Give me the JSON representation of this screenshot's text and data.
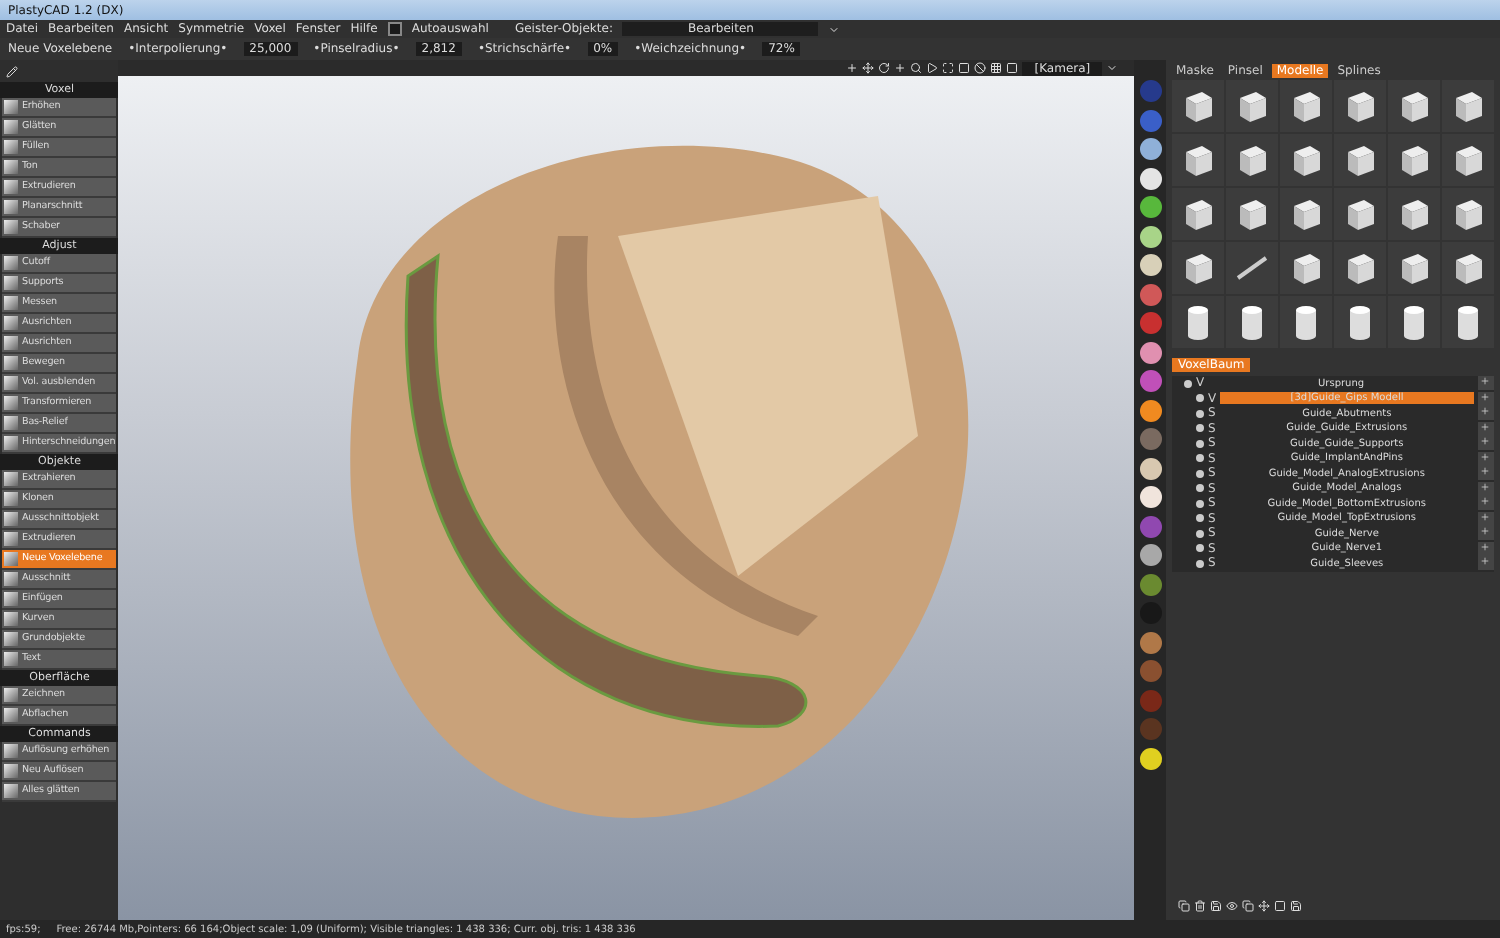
{
  "window": {
    "title": "PlastyCAD 1.2 (DX)"
  },
  "menu": [
    "Datei",
    "Bearbeiten",
    "Ansicht",
    "Symmetrie",
    "Voxel",
    "Fenster",
    "Hilfe"
  ],
  "autoselect": {
    "label": "Autoauswahl",
    "checked": false
  },
  "ghost_objects": {
    "label": "Geister-Objekte:",
    "value": "Bearbeiten"
  },
  "toolbar": {
    "title": "Neue Voxelebene",
    "fields": [
      {
        "label": "•Interpolierung•",
        "value": "25,000"
      },
      {
        "label": "•Pinselradius•",
        "value": "2,812"
      },
      {
        "label": "•Strichschärfe•",
        "value": "0%"
      },
      {
        "label": "•Weichzeichnung•",
        "value": "72%"
      }
    ]
  },
  "tools": [
    {
      "title": "Voxel",
      "items": [
        {
          "label": "Erhöhen",
          "selected": false
        },
        {
          "label": "Glätten",
          "selected": false
        },
        {
          "label": "Füllen",
          "selected": false
        },
        {
          "label": "Ton",
          "selected": false
        },
        {
          "label": "Extrudieren",
          "selected": false
        },
        {
          "label": "Planarschnitt",
          "selected": false
        },
        {
          "label": "Schaber",
          "selected": false
        }
      ]
    },
    {
      "title": "Adjust",
      "items": [
        {
          "label": "Cutoff",
          "selected": false
        },
        {
          "label": "Supports",
          "selected": false
        },
        {
          "label": "Messen",
          "selected": false
        },
        {
          "label": "Ausrichten",
          "selected": false
        },
        {
          "label": "Ausrichten",
          "selected": false
        },
        {
          "label": "Bewegen",
          "selected": false
        },
        {
          "label": "Vol. ausblenden",
          "selected": false
        },
        {
          "label": "Transformieren",
          "selected": false
        },
        {
          "label": "Bas-Relief",
          "selected": false
        },
        {
          "label": "Hinterschneidungen",
          "selected": false
        }
      ]
    },
    {
      "title": "Objekte",
      "items": [
        {
          "label": "Extrahieren",
          "selected": false
        },
        {
          "label": "Klonen",
          "selected": false
        },
        {
          "label": "Ausschnittobjekt",
          "selected": false
        },
        {
          "label": "Extrudieren",
          "selected": false
        },
        {
          "label": "Neue Voxelebene",
          "selected": true
        },
        {
          "label": "Ausschnitt",
          "selected": false
        },
        {
          "label": "Einfügen",
          "selected": false
        },
        {
          "label": "Kurven",
          "selected": false
        },
        {
          "label": "Grundobjekte",
          "selected": false
        },
        {
          "label": "Text",
          "selected": false
        }
      ]
    },
    {
      "title": "Oberfläche",
      "items": [
        {
          "label": "Zeichnen",
          "selected": false
        },
        {
          "label": "Abflachen",
          "selected": false
        }
      ]
    },
    {
      "title": "Commands",
      "items": [
        {
          "label": "Auflösung erhöhen",
          "selected": false
        },
        {
          "label": "Neu Auflösen",
          "selected": false
        },
        {
          "label": "Alles glätten",
          "selected": false
        }
      ]
    }
  ],
  "camera": {
    "value": "[Kamera]"
  },
  "swatches": [
    {
      "color": "#263a8c"
    },
    {
      "color": "#3a5fc8"
    },
    {
      "color": "#8fb0d8"
    },
    {
      "color": "#e4e4e4"
    },
    {
      "color": "#58b83c"
    },
    {
      "color": "#a8d488"
    },
    {
      "color": "#d8d0b8"
    },
    {
      "color": "#d05858"
    },
    {
      "color": "#c83030"
    },
    {
      "color": "#e090b0"
    },
    {
      "color": "#c050b8"
    },
    {
      "color": "#f08a20"
    },
    {
      "color": "#7a6a60"
    },
    {
      "color": "#d8c8b0"
    },
    {
      "color": "#f0e4dc"
    },
    {
      "color": "#9048b0"
    },
    {
      "color": "#a8a8a8"
    },
    {
      "color": "#6a8a30"
    },
    {
      "color": "#181818"
    },
    {
      "color": "#b07848"
    },
    {
      "color": "#8a5030"
    },
    {
      "color": "#7a2818"
    },
    {
      "color": "#5a3420"
    },
    {
      "color": "#e0d020"
    }
  ],
  "right_tabs": [
    {
      "label": "Maske",
      "selected": false
    },
    {
      "label": "Pinsel",
      "selected": false
    },
    {
      "label": "Modelle",
      "selected": true
    },
    {
      "label": "Splines",
      "selected": false
    }
  ],
  "models": [
    {
      "kind": "cube"
    },
    {
      "kind": "cube"
    },
    {
      "kind": "cube"
    },
    {
      "kind": "cube"
    },
    {
      "kind": "cube"
    },
    {
      "kind": "cube"
    },
    {
      "kind": "cube"
    },
    {
      "kind": "cube"
    },
    {
      "kind": "cube"
    },
    {
      "kind": "cube"
    },
    {
      "kind": "cube"
    },
    {
      "kind": "cube"
    },
    {
      "kind": "cube"
    },
    {
      "kind": "cube"
    },
    {
      "kind": "cube"
    },
    {
      "kind": "cube"
    },
    {
      "kind": "cube"
    },
    {
      "kind": "cube"
    },
    {
      "kind": "cube"
    },
    {
      "kind": "rod"
    },
    {
      "kind": "cube"
    },
    {
      "kind": "cube"
    },
    {
      "kind": "cube"
    },
    {
      "kind": "cube"
    },
    {
      "kind": "cylinder"
    },
    {
      "kind": "cylinder"
    },
    {
      "kind": "cylinder"
    },
    {
      "kind": "cylinder"
    },
    {
      "kind": "cylinder"
    },
    {
      "kind": "cylinder"
    }
  ],
  "tree_tab": {
    "label": "VoxelBaum"
  },
  "tree": [
    {
      "label": "Ursprung",
      "type": "V",
      "selected": false,
      "children": [
        {
          "label": "[3d]Guide_Gips Modell",
          "type": "V",
          "selected": true
        },
        {
          "label": "Guide_Abutments",
          "type": "S",
          "selected": false
        },
        {
          "label": "Guide_Guide_Extrusions",
          "type": "S",
          "selected": false
        },
        {
          "label": "Guide_Guide_Supports",
          "type": "S",
          "selected": false
        },
        {
          "label": "Guide_ImplantAndPins",
          "type": "S",
          "selected": false
        },
        {
          "label": "Guide_Model_AnalogExtrusions",
          "type": "S",
          "selected": false
        },
        {
          "label": "Guide_Model_Analogs",
          "type": "S",
          "selected": false
        },
        {
          "label": "Guide_Model_BottomExtrusions",
          "type": "S",
          "selected": false
        },
        {
          "label": "Guide_Model_TopExtrusions",
          "type": "S",
          "selected": false
        },
        {
          "label": "Guide_Nerve",
          "type": "S",
          "selected": false
        },
        {
          "label": "Guide_Nerve1",
          "type": "S",
          "selected": false
        },
        {
          "label": "Guide_Sleeves",
          "type": "S",
          "selected": false
        }
      ]
    }
  ],
  "status_bar": "fps:59;     Free: 26744 Mb,Pointers: 66 164;Object scale: 1,09 (Uniform); Visible triangles: 1 438 336; Curr. obj. tris: 1 438 336"
}
